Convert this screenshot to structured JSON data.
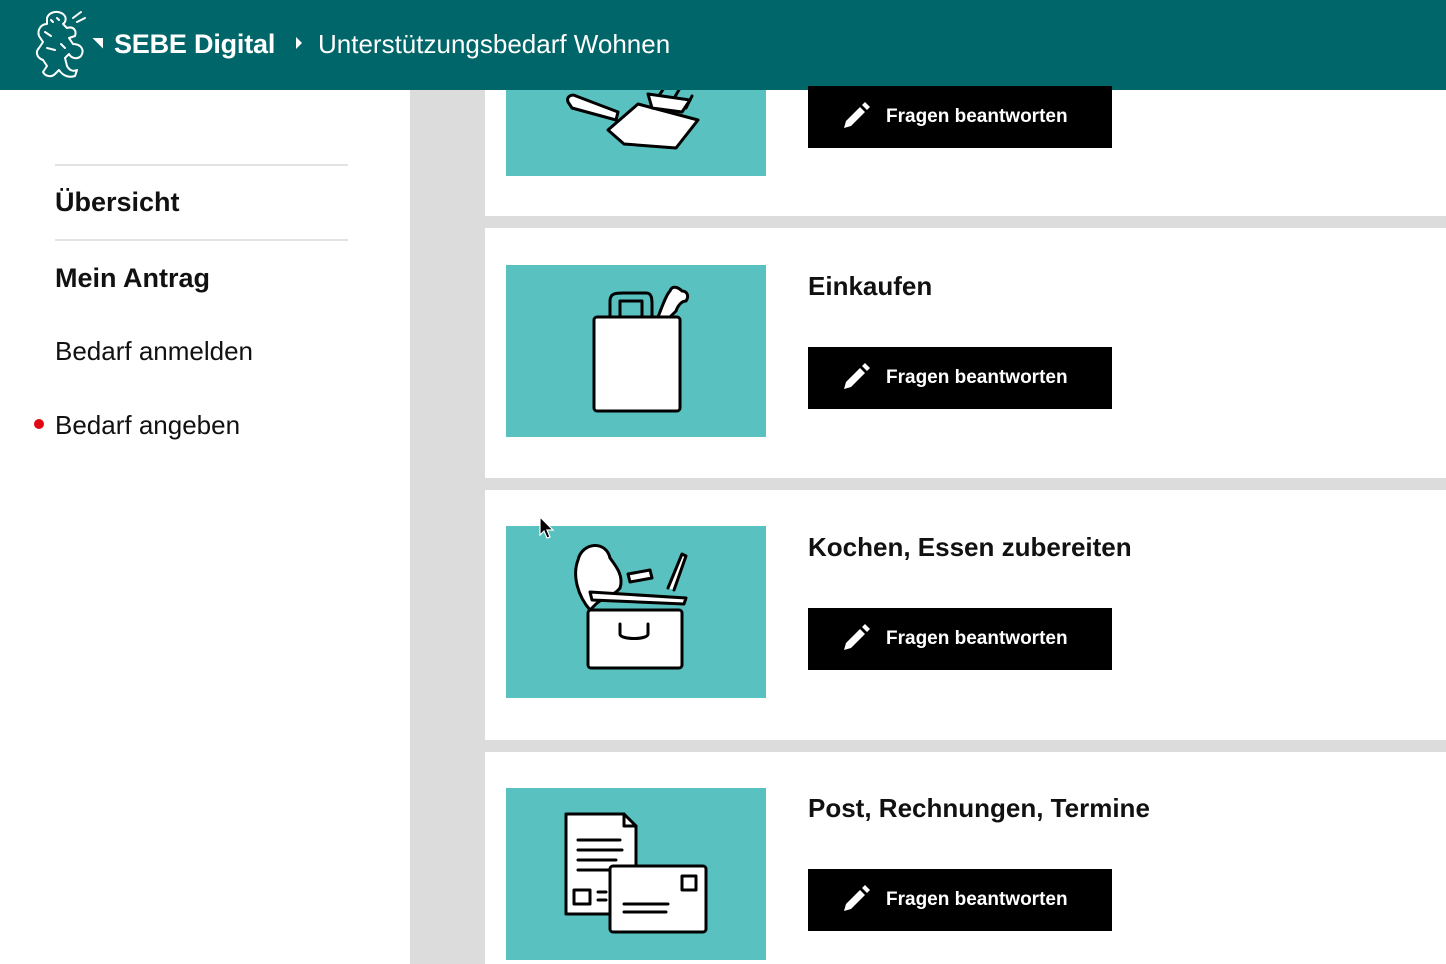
{
  "header": {
    "brand": "SEBE Digital",
    "breadcrumb": "Unterstützungsbedarf Wohnen",
    "logo_icon": "bear-crest-logo-icon"
  },
  "sidebar": {
    "items": [
      {
        "label": "Übersicht"
      },
      {
        "label": "Mein Antrag"
      },
      {
        "label": "Bedarf anmelden"
      },
      {
        "label": "Bedarf angeben",
        "active": true
      }
    ],
    "active_dot_color": "#e30613"
  },
  "cards": [
    {
      "title": "",
      "icon": "cleaning-icon",
      "button_label": "Fragen beantworten"
    },
    {
      "title": "Einkaufen",
      "icon": "shopping-bag-icon",
      "button_label": "Fragen beantworten"
    },
    {
      "title": "Kochen, Essen zubereiten",
      "icon": "cooking-pot-icon",
      "button_label": "Fragen beantworten"
    },
    {
      "title": "Post, Rechnungen, Termine",
      "icon": "mail-documents-icon",
      "button_label": "Fragen beantworten"
    }
  ],
  "colors": {
    "header": "#006669",
    "tile": "#5ac1c1",
    "button": "#000000",
    "main_background": "#dcdcdc"
  }
}
